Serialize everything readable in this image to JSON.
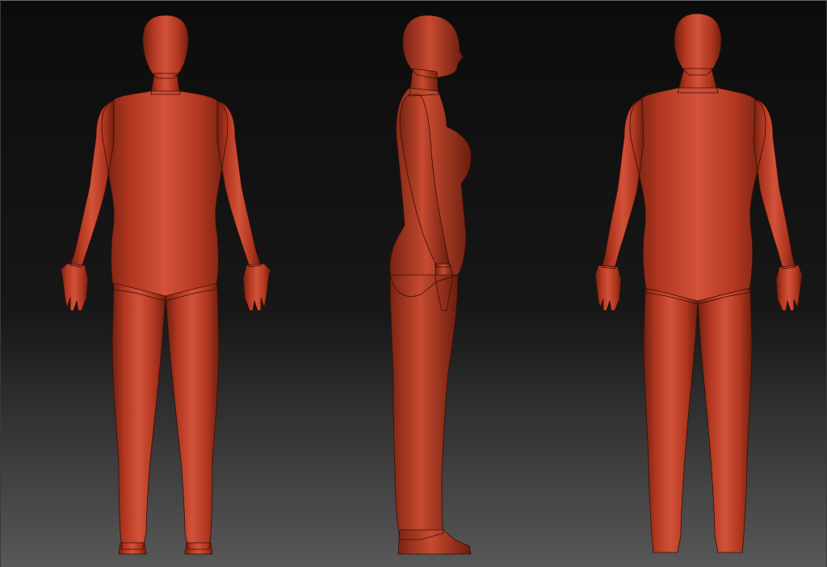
{
  "scene": {
    "views": [
      "front",
      "side",
      "back"
    ],
    "background": {
      "top": "#0c0c0c",
      "mid": "#171717",
      "bottom": "#585858"
    },
    "mesh_colors": {
      "base": "#b8391f",
      "light": "#d8573a",
      "shadow": "#7e2412",
      "deep": "#5a180b",
      "wire": "#2a0a04"
    }
  }
}
